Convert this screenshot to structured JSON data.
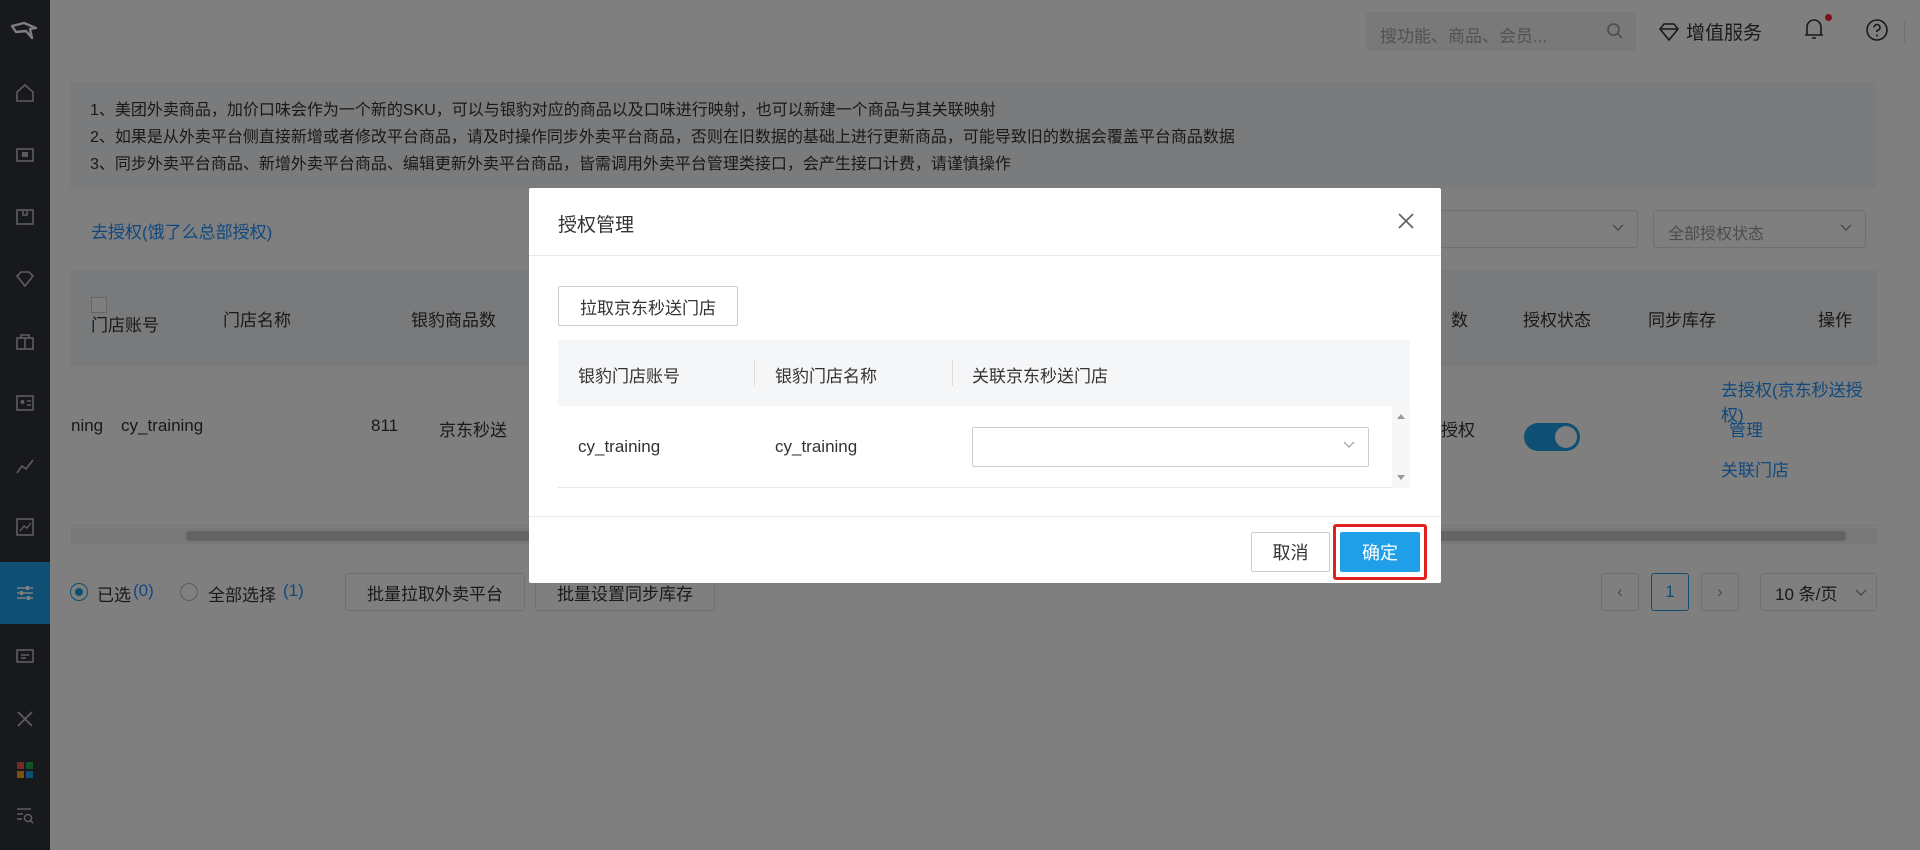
{
  "topbar": {
    "search_placeholder": "搜功能、商品、会员...",
    "vip_label": "增值服务"
  },
  "notice": {
    "lines": [
      "1、美团外卖商品，加价口味会作为一个新的SKU，可以与银豹对应的商品以及口味进行映射，也可以新建一个商品与其关联映射",
      "2、如果是从外卖平台侧直接新增或者修改平台商品，请及时操作同步外卖平台商品，否则在旧数据的基础上进行更新商品，可能导致旧的数据会覆盖平台商品数据",
      "3、同步外卖平台商品、新增外卖平台商品、编辑更新外卖平台商品，皆需调用外卖平台管理类接口，会产生接口计费，请谨慎操作"
    ]
  },
  "auth_link": "去授权(饿了么总部授权)",
  "filters": {
    "auth_status": "全部授权状态"
  },
  "table": {
    "headers": {
      "store_account": "门店账号",
      "store_name": "门店名称",
      "product_count": "银豹商品数",
      "count_tail": "数",
      "auth_status": "授权状态",
      "sync_stock": "同步库存",
      "action": "操作"
    },
    "row": {
      "account_partial": "ning",
      "store_name": "cy_training",
      "product_count": "811",
      "platform": "京东秒送",
      "auth_partial": "授权",
      "sync_stock_on": true
    },
    "actions": {
      "authorize": "去授权(京东秒送授权)",
      "manage": "管理",
      "link_store": "关联门店"
    }
  },
  "bottom": {
    "selected_label": "已选",
    "selected_count": "(0)",
    "select_all_label": "全部选择",
    "select_all_count": "(1)",
    "batch_pull": "批量拉取外卖平台",
    "batch_stock": "批量设置同步库存",
    "page": "1",
    "page_size": "10 条/页"
  },
  "modal": {
    "title": "授权管理",
    "pull_button": "拉取京东秒送门店",
    "columns": [
      "银豹门店账号",
      "银豹门店名称",
      "关联京东秒送门店"
    ],
    "row": {
      "account": "cy_training",
      "name": "cy_training",
      "linked_store": ""
    },
    "cancel": "取消",
    "confirm": "确定"
  },
  "colors": {
    "accent": "#1e9fe8",
    "sidebar": "#2f3238",
    "highlight": "#e02020"
  }
}
